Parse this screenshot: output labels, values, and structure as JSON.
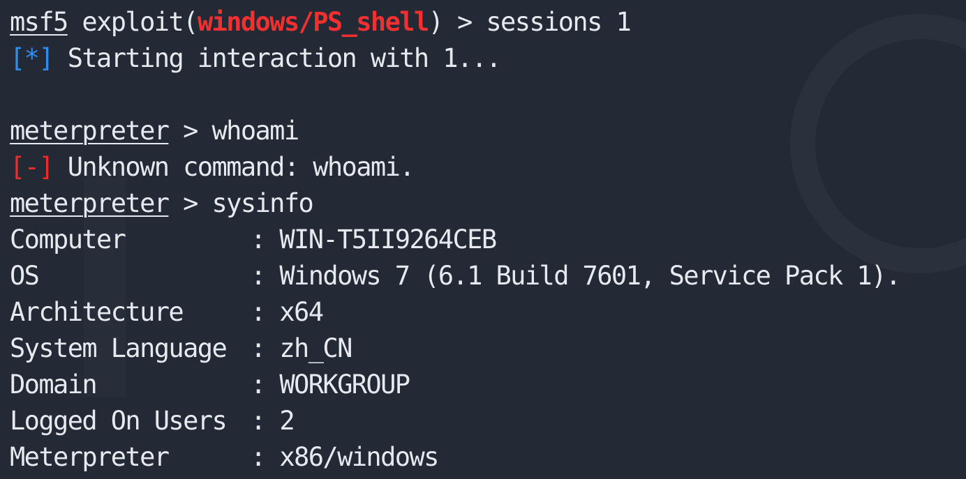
{
  "session": {
    "prompt_name": "msf5",
    "prompt_exploit_prefix": " exploit(",
    "module": "windows/PS_shell",
    "prompt_close": ") > ",
    "command": "sessions 1",
    "info_marker": "[*]",
    "info_text": " Starting interaction with 1..."
  },
  "cmd1": {
    "prompt": "meterpreter",
    "sep": " > ",
    "command": "whoami"
  },
  "err1": {
    "marker": "[-]",
    "text": " Unknown command: whoami."
  },
  "cmd2": {
    "prompt": "meterpreter",
    "sep": " > ",
    "command": "sysinfo"
  },
  "sysinfo": [
    {
      "key": "Computer",
      "sep": ": ",
      "value": "WIN-T5II9264CEB"
    },
    {
      "key": "OS",
      "sep": ": ",
      "value": "Windows 7 (6.1 Build 7601, Service Pack 1)."
    },
    {
      "key": "Architecture",
      "sep": ": ",
      "value": "x64"
    },
    {
      "key": "System Language",
      "sep": ": ",
      "value": "zh_CN"
    },
    {
      "key": "Domain",
      "sep": ": ",
      "value": "WORKGROUP"
    },
    {
      "key": "Logged On Users",
      "sep": ": ",
      "value": "2"
    },
    {
      "key": "Meterpreter",
      "sep": ": ",
      "value": "x86/windows"
    }
  ],
  "colors": {
    "background": "#232a36",
    "text": "#e6e9ee",
    "error": "#ef2a2a",
    "info": "#2f8cf0",
    "module": "#f23030"
  }
}
